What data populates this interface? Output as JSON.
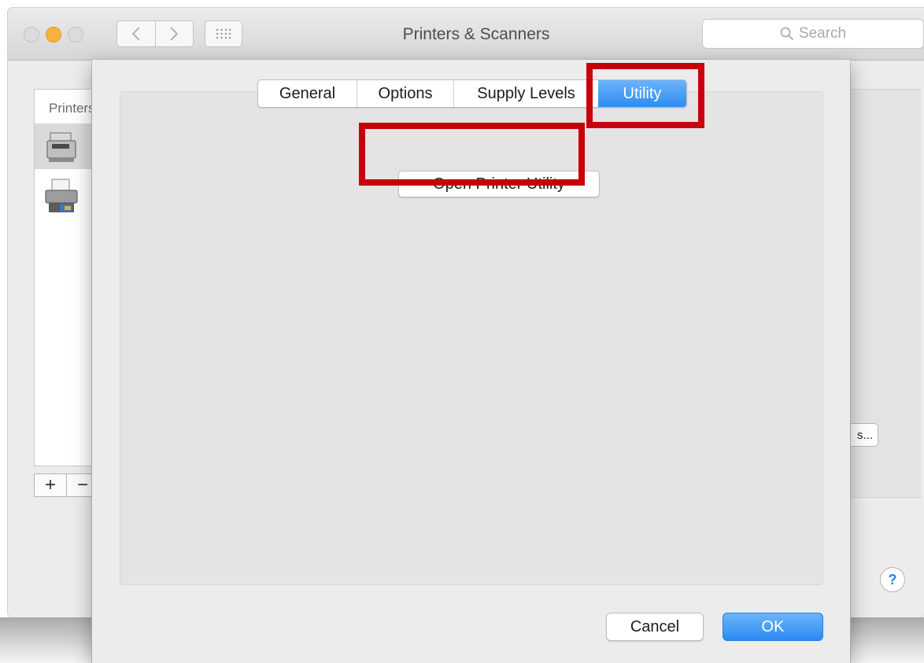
{
  "window": {
    "title": "Printers & Scanners",
    "search_placeholder": "Search",
    "printer_list_header": "Printers",
    "add_label": "+",
    "remove_label": "−",
    "options_button_partial": "s...",
    "help_label": "?"
  },
  "dialog": {
    "tabs": {
      "general": "General",
      "options": "Options",
      "supply_levels": "Supply Levels",
      "utility": "Utility"
    },
    "selected_tab": "Utility",
    "open_utility_label": "Open Printer Utility",
    "cancel_label": "Cancel",
    "ok_label": "OK"
  },
  "icons": {
    "back": "chevron-left-icon",
    "forward": "chevron-right-icon",
    "show_all": "grid-icon",
    "search": "magnifier-icon",
    "printer_1": "laser-printer-icon",
    "printer_2": "inkjet-printer-icon"
  },
  "colors": {
    "accent": "#2f8cf2",
    "highlight": "#c8000a",
    "minimize": "#f6b33c"
  }
}
